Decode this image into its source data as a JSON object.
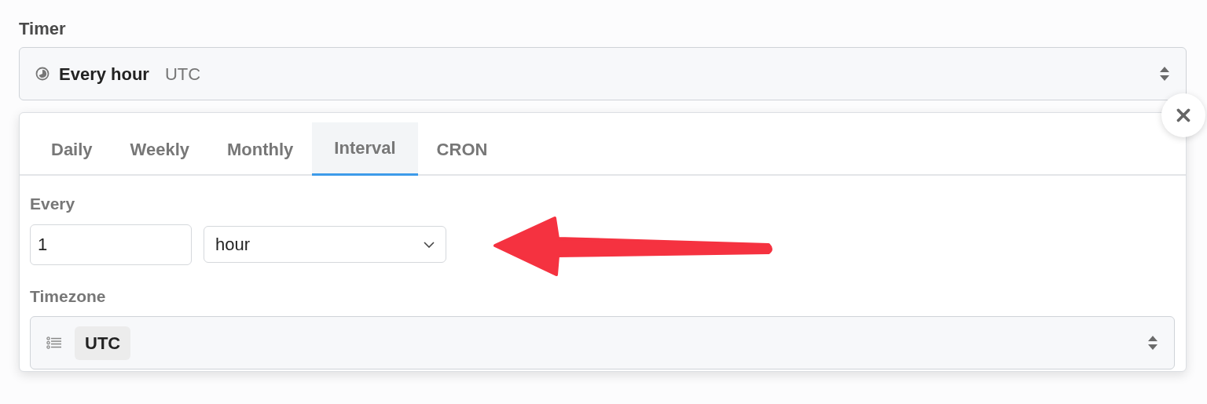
{
  "timer": {
    "label": "Timer",
    "value": "Every hour",
    "timezone": "UTC"
  },
  "popup": {
    "tabs": [
      {
        "label": "Daily",
        "selected": false
      },
      {
        "label": "Weekly",
        "selected": false
      },
      {
        "label": "Monthly",
        "selected": false
      },
      {
        "label": "Interval",
        "selected": true
      },
      {
        "label": "CRON",
        "selected": false
      }
    ],
    "every": {
      "label": "Every",
      "amount": "1",
      "unit": "hour"
    },
    "timezone": {
      "label": "Timezone",
      "value": "UTC"
    }
  }
}
